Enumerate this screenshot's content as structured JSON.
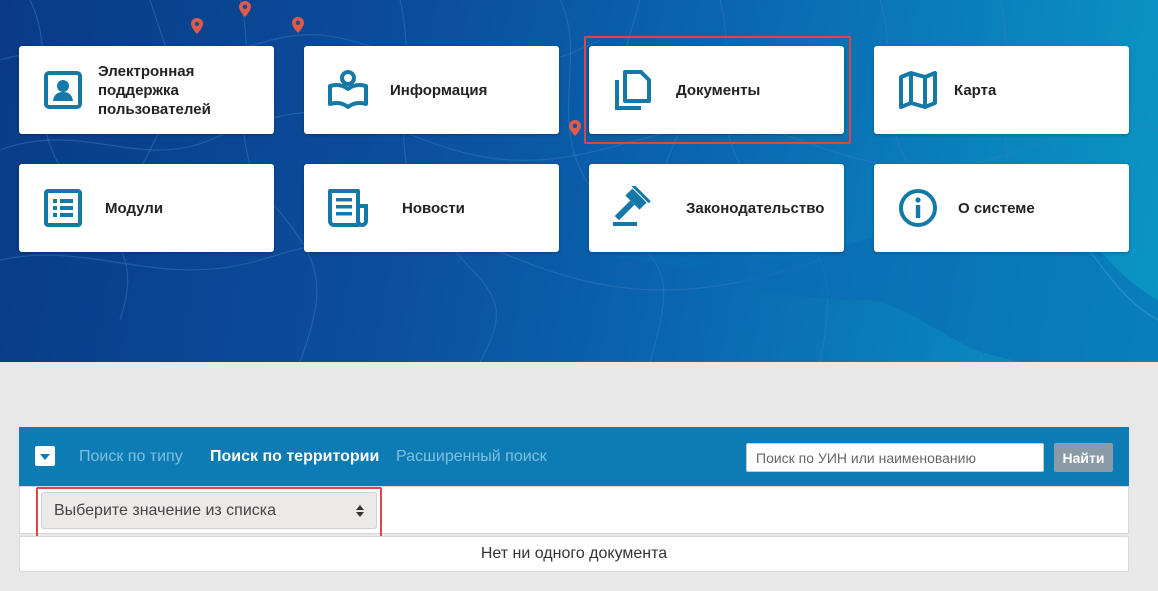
{
  "tiles": [
    {
      "label": "Электронная\nподдержка\nпользователей",
      "icon": "user-card-icon"
    },
    {
      "label": "Информация",
      "icon": "reader-book-icon"
    },
    {
      "label": "Документы",
      "icon": "documents-icon"
    },
    {
      "label": "Карта",
      "icon": "map-icon"
    },
    {
      "label": "Модули",
      "icon": "list-icon"
    },
    {
      "label": "Новости",
      "icon": "newspaper-icon"
    },
    {
      "label": "Законодательство",
      "icon": "gavel-icon"
    },
    {
      "label": "О системе",
      "icon": "info-circle-icon"
    }
  ],
  "search": {
    "tabs": [
      "Поиск по типу",
      "Поиск по территории",
      "Расширенный поиск"
    ],
    "active_tab": "Поиск по территории",
    "input_placeholder": "Поиск по УИН или наименованию",
    "input_value": "",
    "button_label": "Найти"
  },
  "filter": {
    "select_value": "Выберите значение из списка"
  },
  "results": {
    "empty_message": "Нет ни одного документа"
  },
  "colors": {
    "accent": "#0d7bb4",
    "icon": "#1579a8",
    "highlight": "#e04545",
    "pin": "#e05a4a"
  }
}
